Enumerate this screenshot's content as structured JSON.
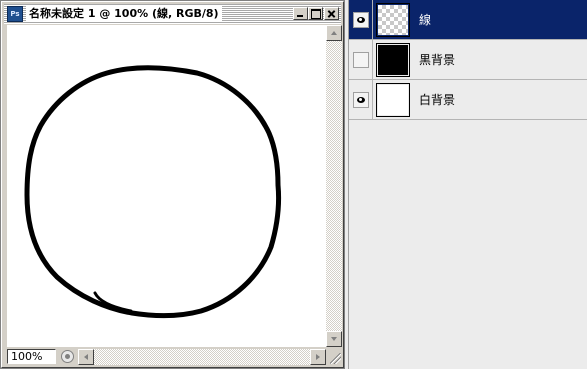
{
  "document_window": {
    "app_icon": "ps-icon",
    "title": "名称未設定 1 @ 100% (線, RGB/8)",
    "zoom_level": "100%"
  },
  "canvas": {
    "stroke_color": "#000000",
    "background_color": "#ffffff"
  },
  "layers": [
    {
      "name": "線",
      "visible": true,
      "selected": true,
      "thumbnail": "transparent"
    },
    {
      "name": "黒背景",
      "visible": false,
      "selected": false,
      "thumbnail": "black"
    },
    {
      "name": "白背景",
      "visible": true,
      "selected": false,
      "thumbnail": "white"
    }
  ],
  "colors": {
    "selection": "#0a246a",
    "window_chrome": "#d4d0c8",
    "panel_bg": "#ececec"
  }
}
